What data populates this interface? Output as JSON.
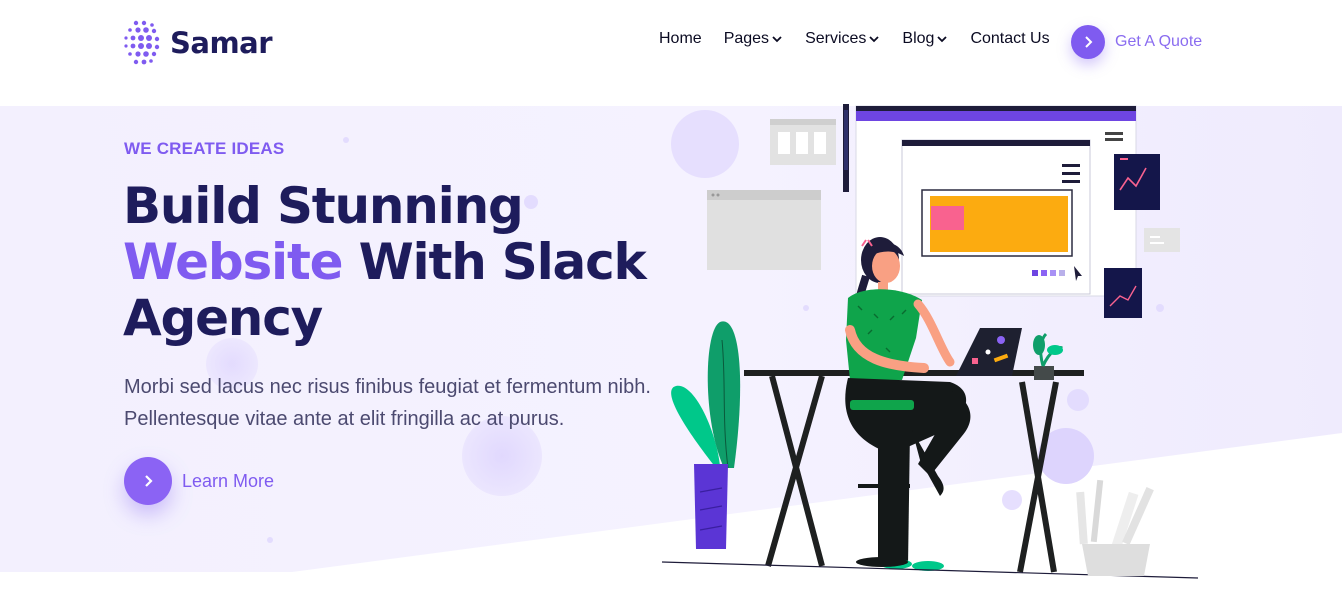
{
  "brand": {
    "name": "Samar",
    "color": "#1e1c5c",
    "accent": "#7f5bf0"
  },
  "nav": {
    "items": [
      {
        "label": "Home",
        "dropdown": false
      },
      {
        "label": "Pages",
        "dropdown": true
      },
      {
        "label": "Services",
        "dropdown": true
      },
      {
        "label": "Blog",
        "dropdown": true
      },
      {
        "label": "Contact Us",
        "dropdown": false
      }
    ],
    "cta_label": "Get A Quote",
    "cta_icon": "chevron-right-icon"
  },
  "hero": {
    "eyebrow": "WE CREATE IDEAS",
    "headline_line1": "Build Stunning",
    "headline_accent": "Website",
    "headline_line2_rest": " With Slack",
    "headline_line3": "Agency",
    "lead": "Morbi sed lacus nec risus finibus feugiat et fermentum nibh. Pellentesque vitae ante at elit fringilla ac at purus.",
    "button_label": "Learn More",
    "button_icon": "chevron-right-icon",
    "illustration": "person-working-at-laptop-desk-illustration"
  }
}
